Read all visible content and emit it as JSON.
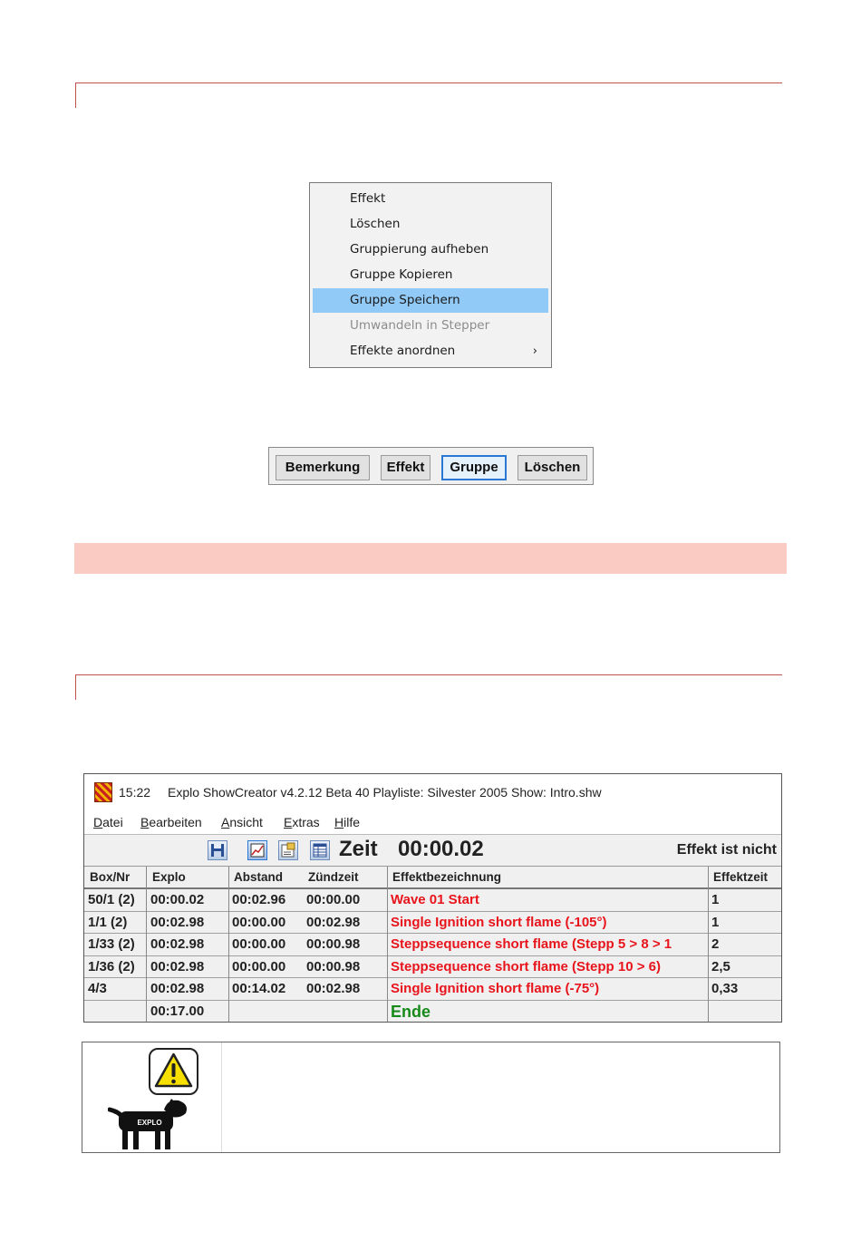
{
  "context_menu": {
    "items": [
      {
        "label": "Effekt",
        "state": "normal"
      },
      {
        "label": "Löschen",
        "state": "normal"
      },
      {
        "label": "Gruppierung aufheben",
        "state": "normal"
      },
      {
        "label": "Gruppe Kopieren",
        "state": "normal"
      },
      {
        "label": "Gruppe Speichern",
        "state": "selected"
      },
      {
        "label": "Umwandeln in Stepper",
        "state": "disabled"
      },
      {
        "label": "Effekte anordnen",
        "state": "normal",
        "submenu_arrow": "›"
      }
    ]
  },
  "button_bar": {
    "buttons": [
      {
        "label": "Bemerkung",
        "focused": false
      },
      {
        "label": "Effekt",
        "focused": false
      },
      {
        "label": "Gruppe",
        "focused": true
      },
      {
        "label": "Löschen",
        "focused": false
      }
    ]
  },
  "app": {
    "title_time": "15:22",
    "title_text": "Explo ShowCreator v4.2.12 Beta 40   Playliste: Silvester 2005  Show: Intro.shw",
    "menu": [
      {
        "first": "D",
        "rest": "atei"
      },
      {
        "first": "B",
        "rest": "earbeiten"
      },
      {
        "first": "A",
        "rest": "nsicht"
      },
      {
        "first": "E",
        "rest": "xtras"
      },
      {
        "first": "H",
        "rest": "ilfe"
      }
    ],
    "toolbar": {
      "icons": [
        "save-icon",
        "chart-icon",
        "properties-icon",
        "table-icon"
      ],
      "zeit_label": "Zeit",
      "zeit_value": "00:00.02",
      "status": "Effekt ist nicht"
    },
    "table": {
      "headers": [
        "Box/Nr",
        "Explo",
        "Abstand",
        "Zündzeit",
        "Effektbezeichnung",
        "Effektzeit"
      ],
      "rows": [
        {
          "box": "50/1 (2)",
          "explo": "00:00.02",
          "abstand": "00:02.96",
          "zuend": "00:00.00",
          "effekt": "Wave 01 Start",
          "zeit": "1"
        },
        {
          "box": "1/1 (2)",
          "explo": "00:02.98",
          "abstand": "00:00.00",
          "zuend": "00:02.98",
          "effekt": "Single Ignition short flame (-105°)",
          "zeit": "1"
        },
        {
          "box": "1/33 (2)",
          "explo": "00:02.98",
          "abstand": "00:00.00",
          "zuend": "00:00.98",
          "effekt": "Steppsequence short flame (Stepp 5 > 8 > 1",
          "zeit": "2"
        },
        {
          "box": "1/36 (2)",
          "explo": "00:02.98",
          "abstand": "00:00.00",
          "zuend": "00:00.98",
          "effekt": "Steppsequence short flame (Stepp 10 > 6)",
          "zeit": "2,5"
        },
        {
          "box": "4/3",
          "explo": "00:02.98",
          "abstand": "00:14.02",
          "zuend": "00:02.98",
          "effekt": "Single Ignition short flame (-75°)",
          "zeit": "0,33"
        },
        {
          "box": "",
          "explo": "00:17.00",
          "abstand": "",
          "zuend": "",
          "effekt": "Ende",
          "zeit": ""
        }
      ]
    }
  },
  "note": {
    "dog_label": "EXPLO",
    "icon": "warning-icon"
  },
  "colors": {
    "accent_rule": "#c0504d",
    "pink_band": "#f9cbc2",
    "menu_highlight": "#91c9f7",
    "effect_red": "#e8141c",
    "end_green": "#188a1a"
  }
}
